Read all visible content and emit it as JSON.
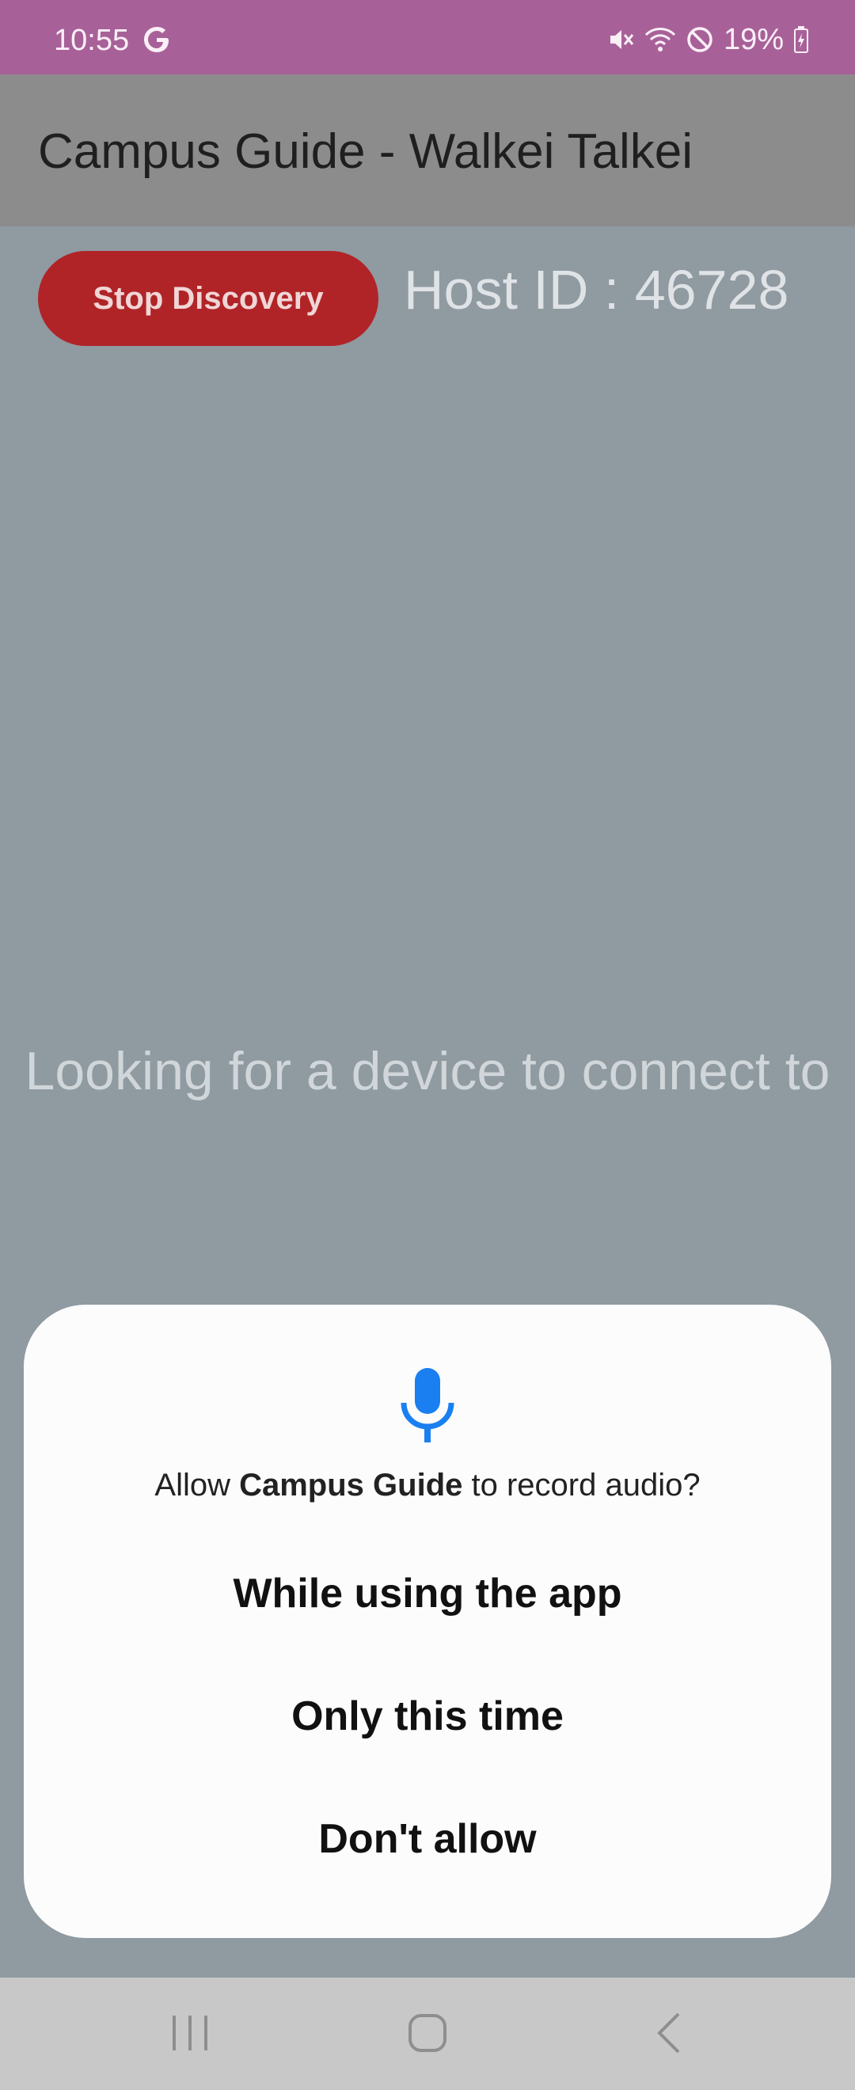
{
  "status_bar": {
    "time": "10:55",
    "battery": "19%",
    "icons": [
      "google-icon",
      "mute-icon",
      "wifi-icon",
      "dnd-icon",
      "battery-icon"
    ]
  },
  "app_bar": {
    "title": "Campus Guide - Walkei Talkei"
  },
  "main": {
    "stop_button_label": "Stop Discovery",
    "host_id": "Host ID : 46728",
    "looking_text": "Looking for a device to connect to"
  },
  "dialog": {
    "icon": "microphone-icon",
    "question_prefix": "Allow ",
    "app_name": "Campus Guide",
    "question_suffix": " to record audio?",
    "options": [
      "While using the app",
      "Only this time",
      "Don't allow"
    ]
  },
  "nav_bar": {
    "icons": [
      "recent-apps-icon",
      "home-icon",
      "back-icon"
    ]
  },
  "colors": {
    "status_bar": "#a86198",
    "background": "#8f9aa1",
    "app_bar": "#8d8c8d",
    "stop_button": "#b02428",
    "mic_accent": "#1a7ff0",
    "dialog_bg": "#fcfcfc",
    "nav_bar": "#c8c8c8"
  }
}
